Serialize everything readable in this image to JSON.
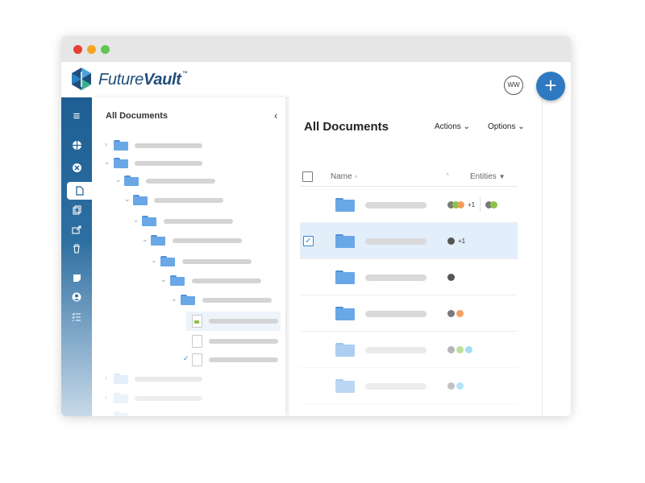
{
  "brand": {
    "name_light": "Future",
    "name_bold": "Vault",
    "tm": "™",
    "logo_icon": "futurevault-logo-icon"
  },
  "header": {
    "avatar_initials": "WW",
    "add_label": "+"
  },
  "sidebar": {
    "items": [
      {
        "icon": "menu-icon",
        "glyph": "≡"
      },
      {
        "icon": "globe-icon",
        "glyph": "◐"
      },
      {
        "icon": "close-circle-icon",
        "glyph": "✕"
      },
      {
        "icon": "document-icon",
        "glyph": "▯",
        "active": true
      },
      {
        "icon": "copy-icon",
        "glyph": "❐"
      },
      {
        "icon": "share-icon",
        "glyph": "⇪"
      },
      {
        "icon": "trash-icon",
        "glyph": "🗑"
      },
      {
        "icon": "note-icon",
        "glyph": "▪"
      },
      {
        "icon": "user-icon",
        "glyph": "●"
      },
      {
        "icon": "checklist-icon",
        "glyph": "☰"
      }
    ]
  },
  "tree": {
    "title": "All Documents",
    "collapse_glyph": "‹"
  },
  "main": {
    "title": "All Documents",
    "actions_label": "Actions",
    "options_label": "Options",
    "columns": {
      "name": "Name",
      "entities": "Entities"
    },
    "rows": [
      {
        "selected": false,
        "entities": [
          "#7a7a7a",
          "#8bc34a",
          "#f39c5a"
        ],
        "extra": "+1",
        "extra2": [
          "#7a7a7a",
          "#8bc34a"
        ]
      },
      {
        "selected": true,
        "entities": [
          "#555555"
        ],
        "extra": "+1"
      },
      {
        "selected": false,
        "entities": [
          "#555555"
        ]
      },
      {
        "selected": false,
        "entities": [
          "#7a7a7a",
          "#f3a060"
        ]
      },
      {
        "selected": false,
        "entities": [
          "#a9a9a9",
          "#b8dd84",
          "#a8dcf4"
        ],
        "faded": true
      },
      {
        "selected": false,
        "entities": [
          "#a9a9a9",
          "#a8dcf4"
        ],
        "faded": true
      }
    ]
  },
  "colors": {
    "accent": "#2f79c2",
    "sidebar": "#1e5e92",
    "folder": "#6aa7e6",
    "selected_row": "#e3eefb"
  }
}
